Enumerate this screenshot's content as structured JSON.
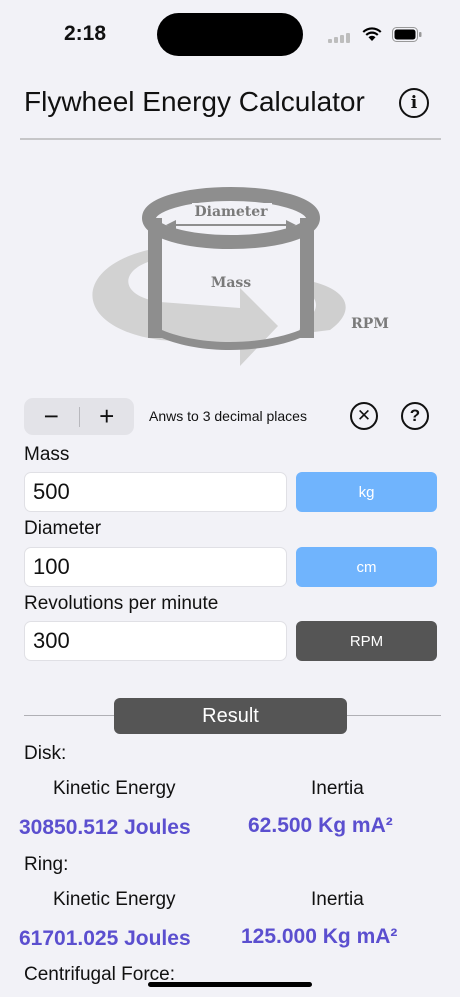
{
  "status_bar": {
    "time": "2:18"
  },
  "header": {
    "title": "Flywheel Energy Calculator",
    "info_icon": "info-icon"
  },
  "diagram": {
    "label_diameter": "Diameter",
    "label_mass": "Mass",
    "label_rpm": "RPM"
  },
  "controls": {
    "minus": "−",
    "plus": "+",
    "decimals_text": "Anws to 3 decimal places",
    "clear_icon": "clear-icon",
    "help_icon": "help-icon"
  },
  "inputs": {
    "mass": {
      "label": "Mass",
      "value": "500",
      "unit": "kg"
    },
    "diameter": {
      "label": "Diameter",
      "value": "100",
      "unit": "cm"
    },
    "rpm": {
      "label": "Revolutions per minute",
      "value": "300",
      "unit": "RPM"
    }
  },
  "result": {
    "button_label": "Result",
    "disk": {
      "label": "Disk:",
      "ke_header": "Kinetic Energy",
      "inertia_header": "Inertia",
      "ke_value": "30850.512 Joules",
      "inertia_value": "62.500 Kg mA²"
    },
    "ring": {
      "label": "Ring:",
      "ke_header": "Kinetic Energy",
      "inertia_header": "Inertia",
      "ke_value": "61701.025 Joules",
      "inertia_value": "125.000 Kg mA²"
    },
    "centrifugal_label": "Centrifugal Force:"
  },
  "colors": {
    "accent_blue": "#70b4fd",
    "result_purple": "#5b4fcf",
    "dark_button": "#555555"
  }
}
